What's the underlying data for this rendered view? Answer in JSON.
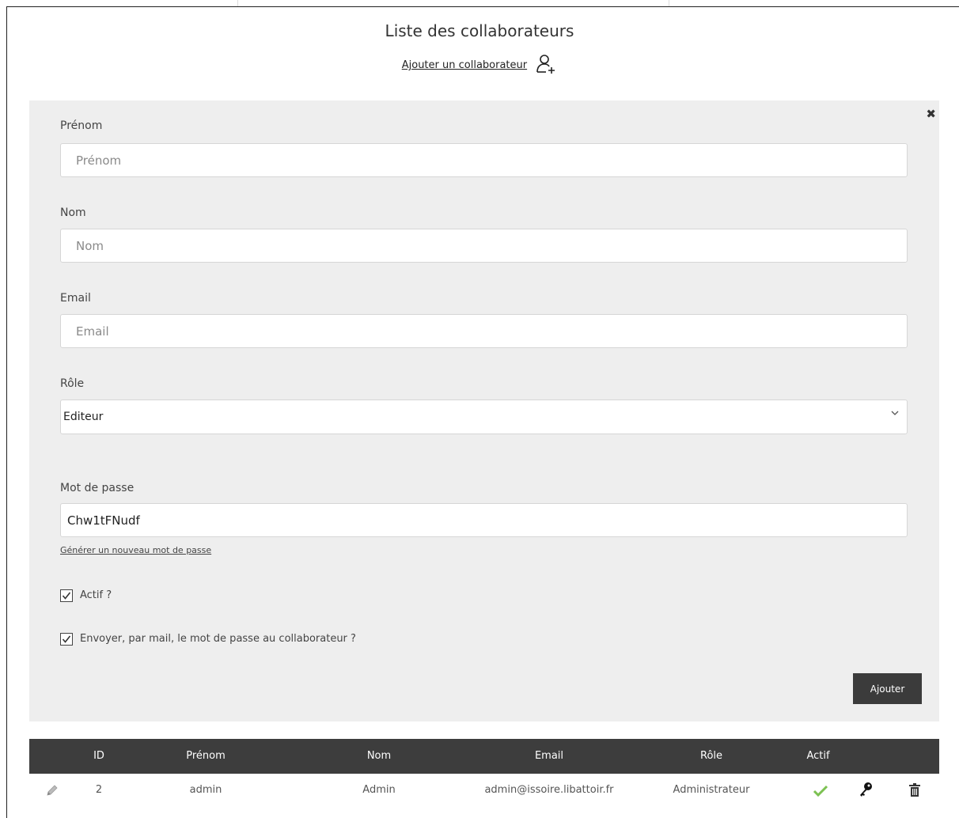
{
  "page": {
    "title": "Liste des collaborateurs",
    "add_link": "Ajouter un collaborateur"
  },
  "form": {
    "first_name": {
      "label": "Prénom",
      "placeholder": "Prénom",
      "value": ""
    },
    "last_name": {
      "label": "Nom",
      "placeholder": "Nom",
      "value": ""
    },
    "email": {
      "label": "Email",
      "placeholder": "Email",
      "value": ""
    },
    "role": {
      "label": "Rôle",
      "selected": "Editeur"
    },
    "password": {
      "label": "Mot de passe",
      "value": "Chw1tFNudf"
    },
    "generate_link": "Générer un nouveau mot de passe",
    "active_checkbox": {
      "label": "Actif ?",
      "checked": true
    },
    "send_mail_checkbox": {
      "label": "Envoyer, par mail, le mot de passe au collaborateur ?",
      "checked": true
    },
    "submit_label": "Ajouter"
  },
  "table": {
    "columns": [
      "ID",
      "Prénom",
      "Nom",
      "Email",
      "Rôle",
      "Actif"
    ],
    "rows": [
      {
        "id": "2",
        "first_name": "admin",
        "last_name": "Admin",
        "email": "admin@issoire.libattoir.fr",
        "role": "Administrateur",
        "active": true
      }
    ]
  },
  "icons": {
    "add_user": "user-plus-icon",
    "close": "close-icon",
    "edit": "pencil-icon",
    "active": "check-icon",
    "password": "key-icon",
    "delete": "trash-icon"
  },
  "colors": {
    "panel_bg": "#eeeeee",
    "header_bg": "#3d3d3d",
    "button_bg": "#3b3b3b",
    "check_green": "#7cc152"
  }
}
